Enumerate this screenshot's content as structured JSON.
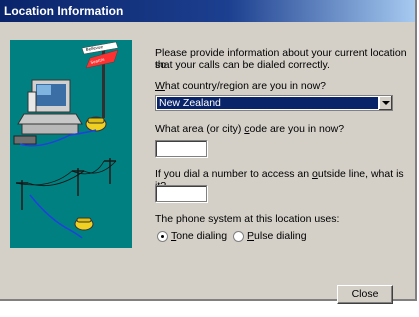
{
  "window": {
    "title": "Location Information"
  },
  "sign": {
    "left": "Bellevue",
    "right": "Seattle"
  },
  "intro": {
    "line1": "Please provide information about your current location so",
    "line2": "that your calls can be dialed correctly."
  },
  "country": {
    "label_pre": "W",
    "label_rest": "hat country/region are you in now?",
    "selected": "New Zealand"
  },
  "area": {
    "label_pre": "What area (or city) ",
    "label_u": "c",
    "label_rest": "ode are you in now?",
    "value": ""
  },
  "outside": {
    "label_pre": "If you dial a number to access an ",
    "label_u": "o",
    "label_rest": "utside line, what is it?",
    "value": ""
  },
  "phone_system": {
    "label": "The phone system at this location uses:",
    "tone": {
      "u": "T",
      "rest": "one dialing",
      "selected": true
    },
    "pulse": {
      "u": "P",
      "rest": "ulse dialing",
      "selected": false
    }
  },
  "close_button": {
    "label": "Close"
  },
  "colors": {
    "illustration_bg": "#008080",
    "titlebar": "#0a246a",
    "selection": "#0a246a"
  }
}
